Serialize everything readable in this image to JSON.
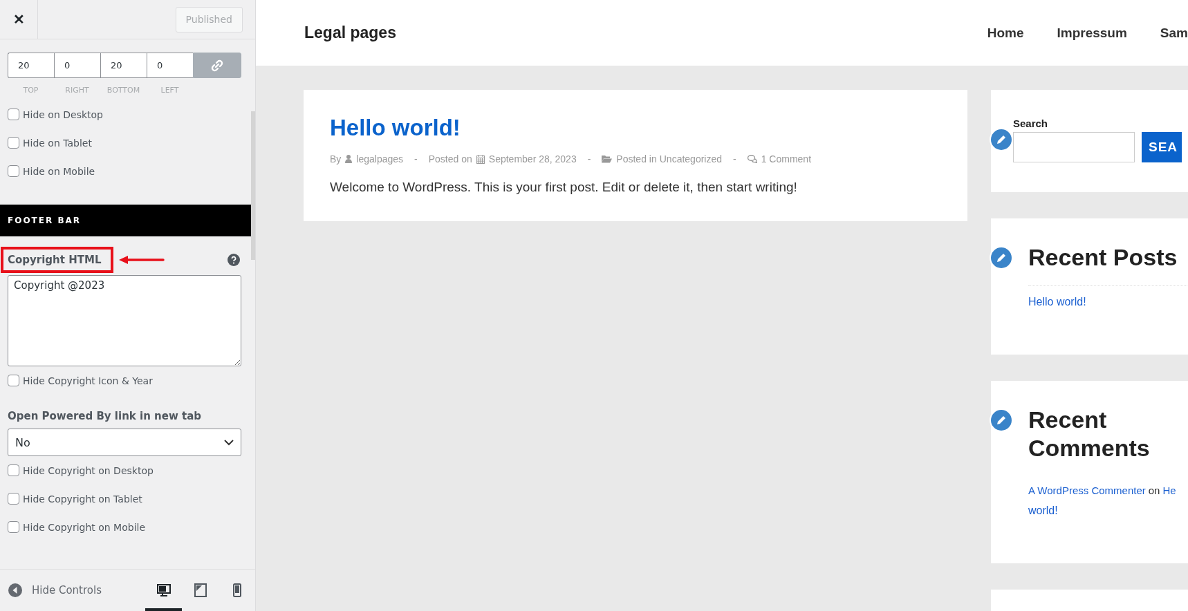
{
  "customizer": {
    "close_icon": "✕",
    "publish_button": {
      "label": "Published",
      "disabled": true
    },
    "padding": {
      "values": [
        {
          "value": "20",
          "label": "TOP"
        },
        {
          "value": "0",
          "label": "RIGHT"
        },
        {
          "value": "20",
          "label": "BOTTOM"
        },
        {
          "value": "0",
          "label": "LEFT"
        }
      ],
      "linked": true
    },
    "visibility": [
      {
        "label": "Hide on Desktop",
        "checked": false
      },
      {
        "label": "Hide on Tablet",
        "checked": false
      },
      {
        "label": "Hide on Mobile",
        "checked": false
      }
    ],
    "section_title": "FOOTER BAR",
    "copyright": {
      "label": "Copyright HTML",
      "annotated": true,
      "value": "Copyright @2023"
    },
    "copyright_options": [
      {
        "label": "Hide Copyright Icon & Year",
        "checked": false
      }
    ],
    "powered_by": {
      "label": "Open Powered By link in new tab",
      "value": "No"
    },
    "copyright_visibility": [
      {
        "label": "Hide Copyright on Desktop",
        "checked": false
      },
      {
        "label": "Hide Copyright on Tablet",
        "checked": false
      },
      {
        "label": "Hide Copyright on Mobile",
        "checked": false
      }
    ],
    "footer": {
      "hide_controls": "Hide Controls",
      "devices": [
        {
          "kind": "desktop",
          "selected": true
        },
        {
          "kind": "tablet",
          "selected": false
        },
        {
          "kind": "mobile",
          "selected": false
        }
      ]
    }
  },
  "preview": {
    "site_title": "Legal pages",
    "nav": [
      "Home",
      "Impressum",
      "Sam"
    ],
    "post": {
      "title": "Hello world!",
      "by": "By",
      "author": "legalpages",
      "posted_on": "Posted on",
      "date": "September 28, 2023",
      "posted_in": "Posted in",
      "category": "Uncategorized",
      "comments": "1 Comment",
      "separator": "-",
      "excerpt": "Welcome to WordPress. This is your first post. Edit or delete it, then start writing!"
    },
    "search": {
      "label": "Search",
      "button": "SEA"
    },
    "recent_posts": {
      "title": "Recent Posts",
      "items": [
        "Hello world!"
      ]
    },
    "recent_comments": {
      "title": "Recent Comments",
      "author": "A WordPress Commenter",
      "on": "on",
      "post_start": "He",
      "post_end": "world!"
    }
  }
}
